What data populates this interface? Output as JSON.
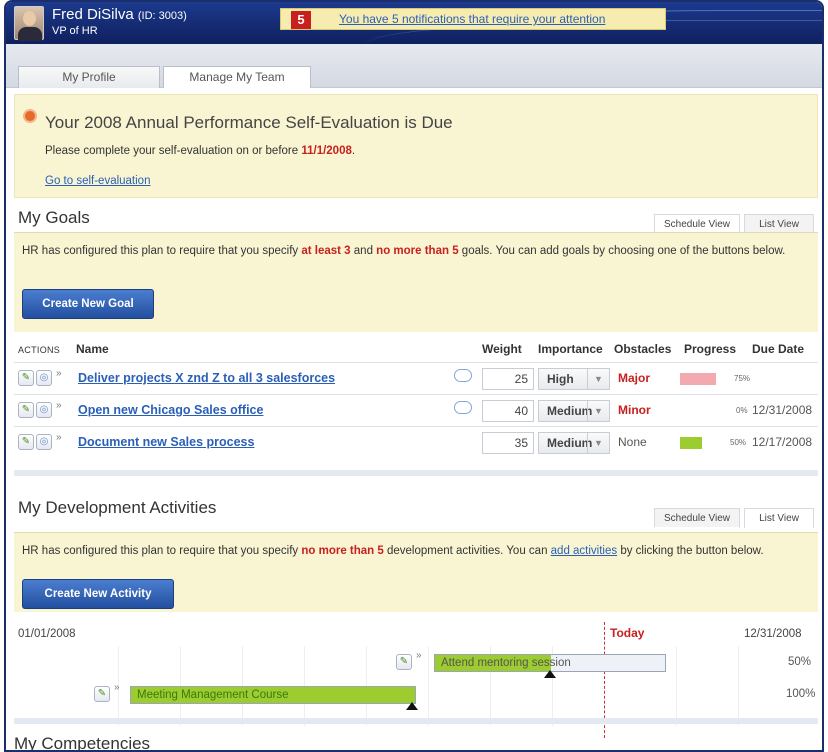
{
  "user": {
    "name": "Fred DiSilva",
    "id_label": "(ID: 3003)",
    "role": "VP of HR"
  },
  "notifications": {
    "count": "5",
    "message": "You have 5 notifications that require your attention"
  },
  "page_tabs": [
    {
      "label": "My Profile"
    },
    {
      "label": "Manage My Team"
    }
  ],
  "due_banner": {
    "title": "Your 2008 Annual Performance Self-Evaluation is Due",
    "subtitle_pre": "Please complete your self-evaluation on or before ",
    "subtitle_date": "11/1/2008",
    "subtitle_post": ".",
    "link": "Go to self-evaluation"
  },
  "goals": {
    "title": "My Goals",
    "view_tabs": [
      "Schedule View",
      "List View"
    ],
    "info_pre": "HR has configured this plan to require that you specify ",
    "info_min": "at least 3",
    "info_mid": " and ",
    "info_max": "no more than 5",
    "info_post": " goals. You can add goals by choosing one of the buttons below.",
    "create_button": "Create New Goal",
    "columns": {
      "actions": "ACTIONS",
      "name": "Name",
      "weight": "Weight",
      "importance": "Importance",
      "obstacles": "Obstacles",
      "progress": "Progress",
      "due": "Due Date"
    },
    "rows": [
      {
        "name": "Deliver projects X znd Z to all 3 salesforces",
        "weight": "25",
        "importance": "High",
        "obstacles": "Major",
        "progress": 0.75,
        "progress_label": "75%",
        "due": ""
      },
      {
        "name": "Open new Chicago Sales office",
        "weight": "40",
        "importance": "Medium",
        "obstacles": "Minor",
        "progress": 0.0,
        "progress_label": "0%",
        "due": "12/31/2008"
      },
      {
        "name": "Document new Sales process",
        "weight": "35",
        "importance": "Medium",
        "obstacles": "None",
        "progress": 0.5,
        "progress_label": "50%",
        "due": "12/17/2008"
      }
    ],
    "colors": {
      "major": "#c8201e",
      "minor": "#c8201e",
      "none": "#555555",
      "progress_pink": "#f2a9b0",
      "progress_green": "#9ccc2f"
    }
  },
  "development": {
    "title": "My Development Activities",
    "view_tabs": [
      "Schedule View",
      "List View"
    ],
    "info_pre": "HR has configured this plan to require that you specify ",
    "info_max": "no more than 5",
    "info_mid": " development activities. You can ",
    "info_link": "add activities",
    "info_post": " by clicking the button below.",
    "create_button": "Create New Activity",
    "timeline_start": "01/01/2008",
    "timeline_end": "12/31/2008",
    "today_label": "Today",
    "activities": [
      {
        "name": "Attend mentoring session",
        "progress_label": "50%",
        "progress": 0.5
      },
      {
        "name": "Meeting Management Course",
        "progress_label": "100%",
        "progress": 1.0
      }
    ]
  },
  "competencies": {
    "title": "My Competencies"
  }
}
